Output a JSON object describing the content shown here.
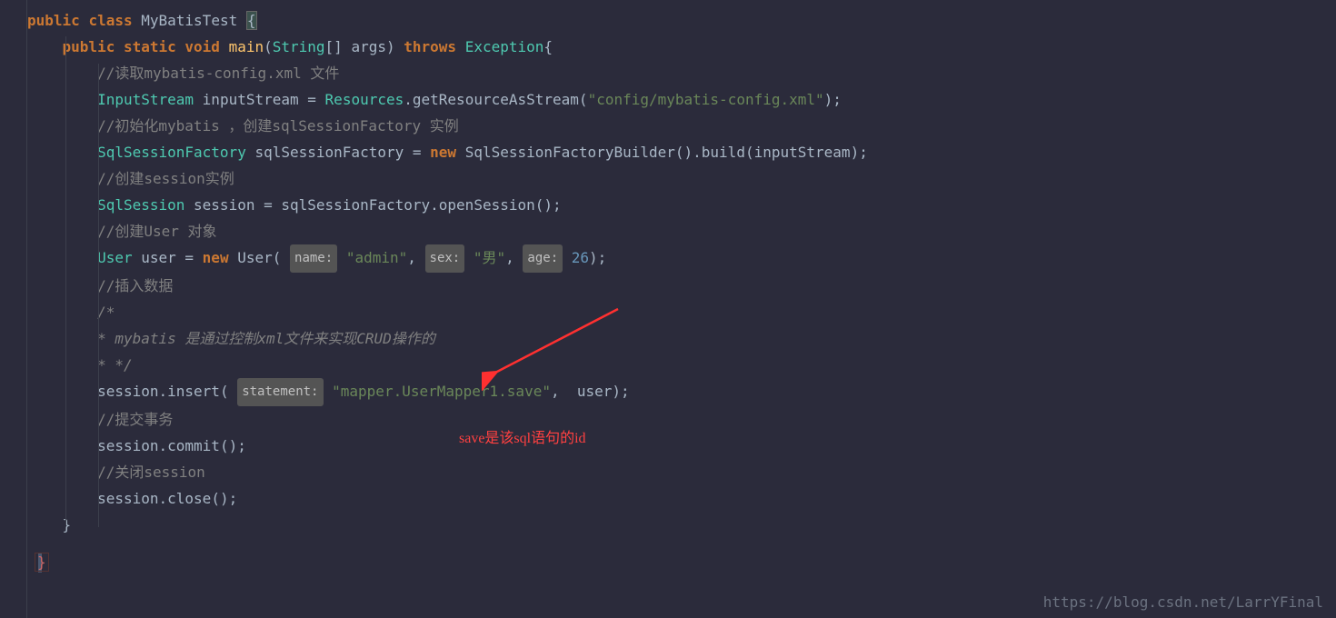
{
  "code": {
    "kw_public": "public",
    "kw_class": "class",
    "kw_static": "static",
    "kw_void": "void",
    "kw_throws": "throws",
    "kw_new": "new",
    "class_name": "MyBatisTest",
    "main": "main",
    "string_type": "String",
    "args": "args",
    "exception": "Exception",
    "comment1": "//读取mybatis-config.xml 文件",
    "inputstream_type": "InputStream",
    "inputstream_var": "inputStream",
    "resources": "Resources",
    "getres": "getResourceAsStream",
    "config_str": "\"config/mybatis-config.xml\"",
    "comment2": "//初始化mybatis ，创建sqlSessionFactory 实例",
    "ssf_type": "SqlSessionFactory",
    "ssf_var": "sqlSessionFactory",
    "ssfb": "SqlSessionFactoryBuilder",
    "build": "build",
    "comment3": "//创建session实例",
    "ss_type": "SqlSession",
    "session": "session",
    "opensession": "openSession",
    "comment4": "//创建User 对象",
    "user_type": "User",
    "user_var": "user",
    "hint_name": "name:",
    "admin_str": "\"admin\"",
    "hint_sex": "sex:",
    "sex_str": "\"男\"",
    "hint_age": "age:",
    "age_val": "26",
    "comment5": "//插入数据",
    "comment6a": "/*",
    "comment6b": "* mybatis 是通过控制xml文件来实现CRUD操作的",
    "comment6c": "* */",
    "insert": "insert",
    "hint_stmt": "statement:",
    "mapper_str": "\"mapper.UserMapper1.save\"",
    "comment7": "//提交事务",
    "commit": "commit",
    "comment8": "//关闭session",
    "close": "close"
  },
  "annotation": "save是该sql语句的id",
  "watermark": "https://blog.csdn.net/LarrYFinal"
}
